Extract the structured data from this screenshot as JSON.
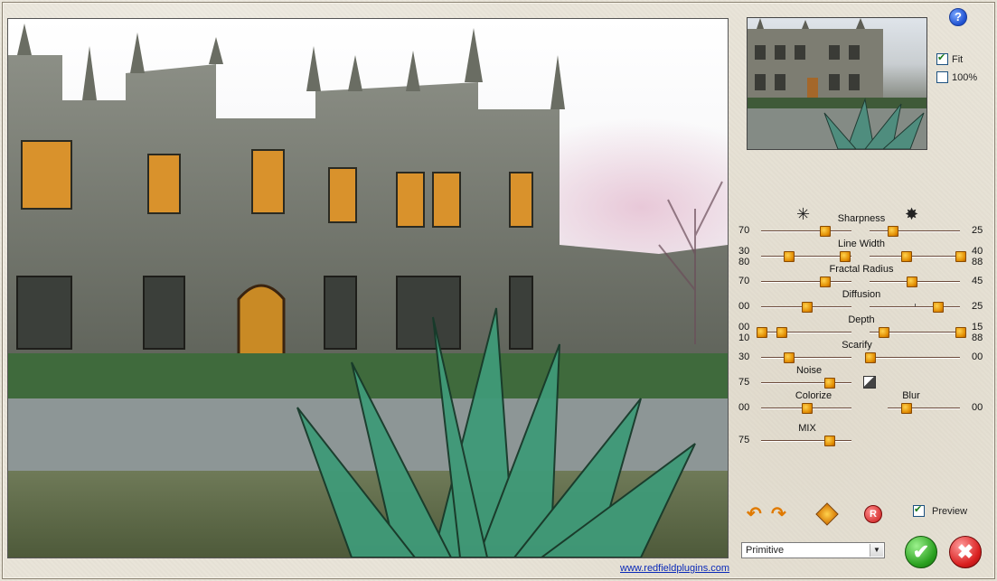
{
  "toolbar": {
    "help_label": "?",
    "fit_label": "Fit",
    "fit_checked": true,
    "full_label": "100%",
    "full_checked": false
  },
  "sliders": {
    "sharpness": {
      "label": "Sharpness",
      "left_value": "70",
      "right_value": "25",
      "left_level": 0.7,
      "right_level": 0.25
    },
    "line_width": {
      "label": "Line Width",
      "left_top": "30",
      "left_bottom": "80",
      "right_top": "40",
      "right_bottom": "88"
    },
    "fractal_radius": {
      "label": "Fractal Radius",
      "left_value": "70",
      "right_value": "45"
    },
    "diffusion": {
      "label": "Diffusion",
      "left_value": "00",
      "right_value": "25"
    },
    "depth": {
      "label": "Depth",
      "left_top": "00",
      "left_bottom": "10",
      "right_top": "15",
      "right_bottom": "88"
    },
    "scarify": {
      "label": "Scarify",
      "left_value": "30",
      "right_value": "00"
    },
    "noise": {
      "label": "Noise",
      "value": "75"
    },
    "colorize": {
      "label": "Colorize",
      "value": "00"
    },
    "blur": {
      "label": "Blur",
      "value": "00"
    },
    "mix": {
      "label": "MIX",
      "value": "75"
    }
  },
  "bottom": {
    "preview_label": "Preview",
    "preview_checked": true,
    "preset_selected": "Primitive",
    "ok_symbol": "✔",
    "cancel_symbol": "✖",
    "reset_symbol": "R",
    "website_link": "www.redfieldplugins.com"
  },
  "icons": {
    "sharpness_left": "sparkle-icon",
    "sharpness_right": "sparkle-burst-icon",
    "undo": "undo-arrow-icon",
    "redo": "redo-arrow-icon",
    "random": "dice-icon",
    "reset": "reset-icon",
    "noise_toggle": "noise-texture-icon"
  },
  "colors": {
    "knob": "#f0a000",
    "ok": "#2aa01f",
    "cancel": "#d91f1f",
    "link": "#0b2ab8"
  }
}
